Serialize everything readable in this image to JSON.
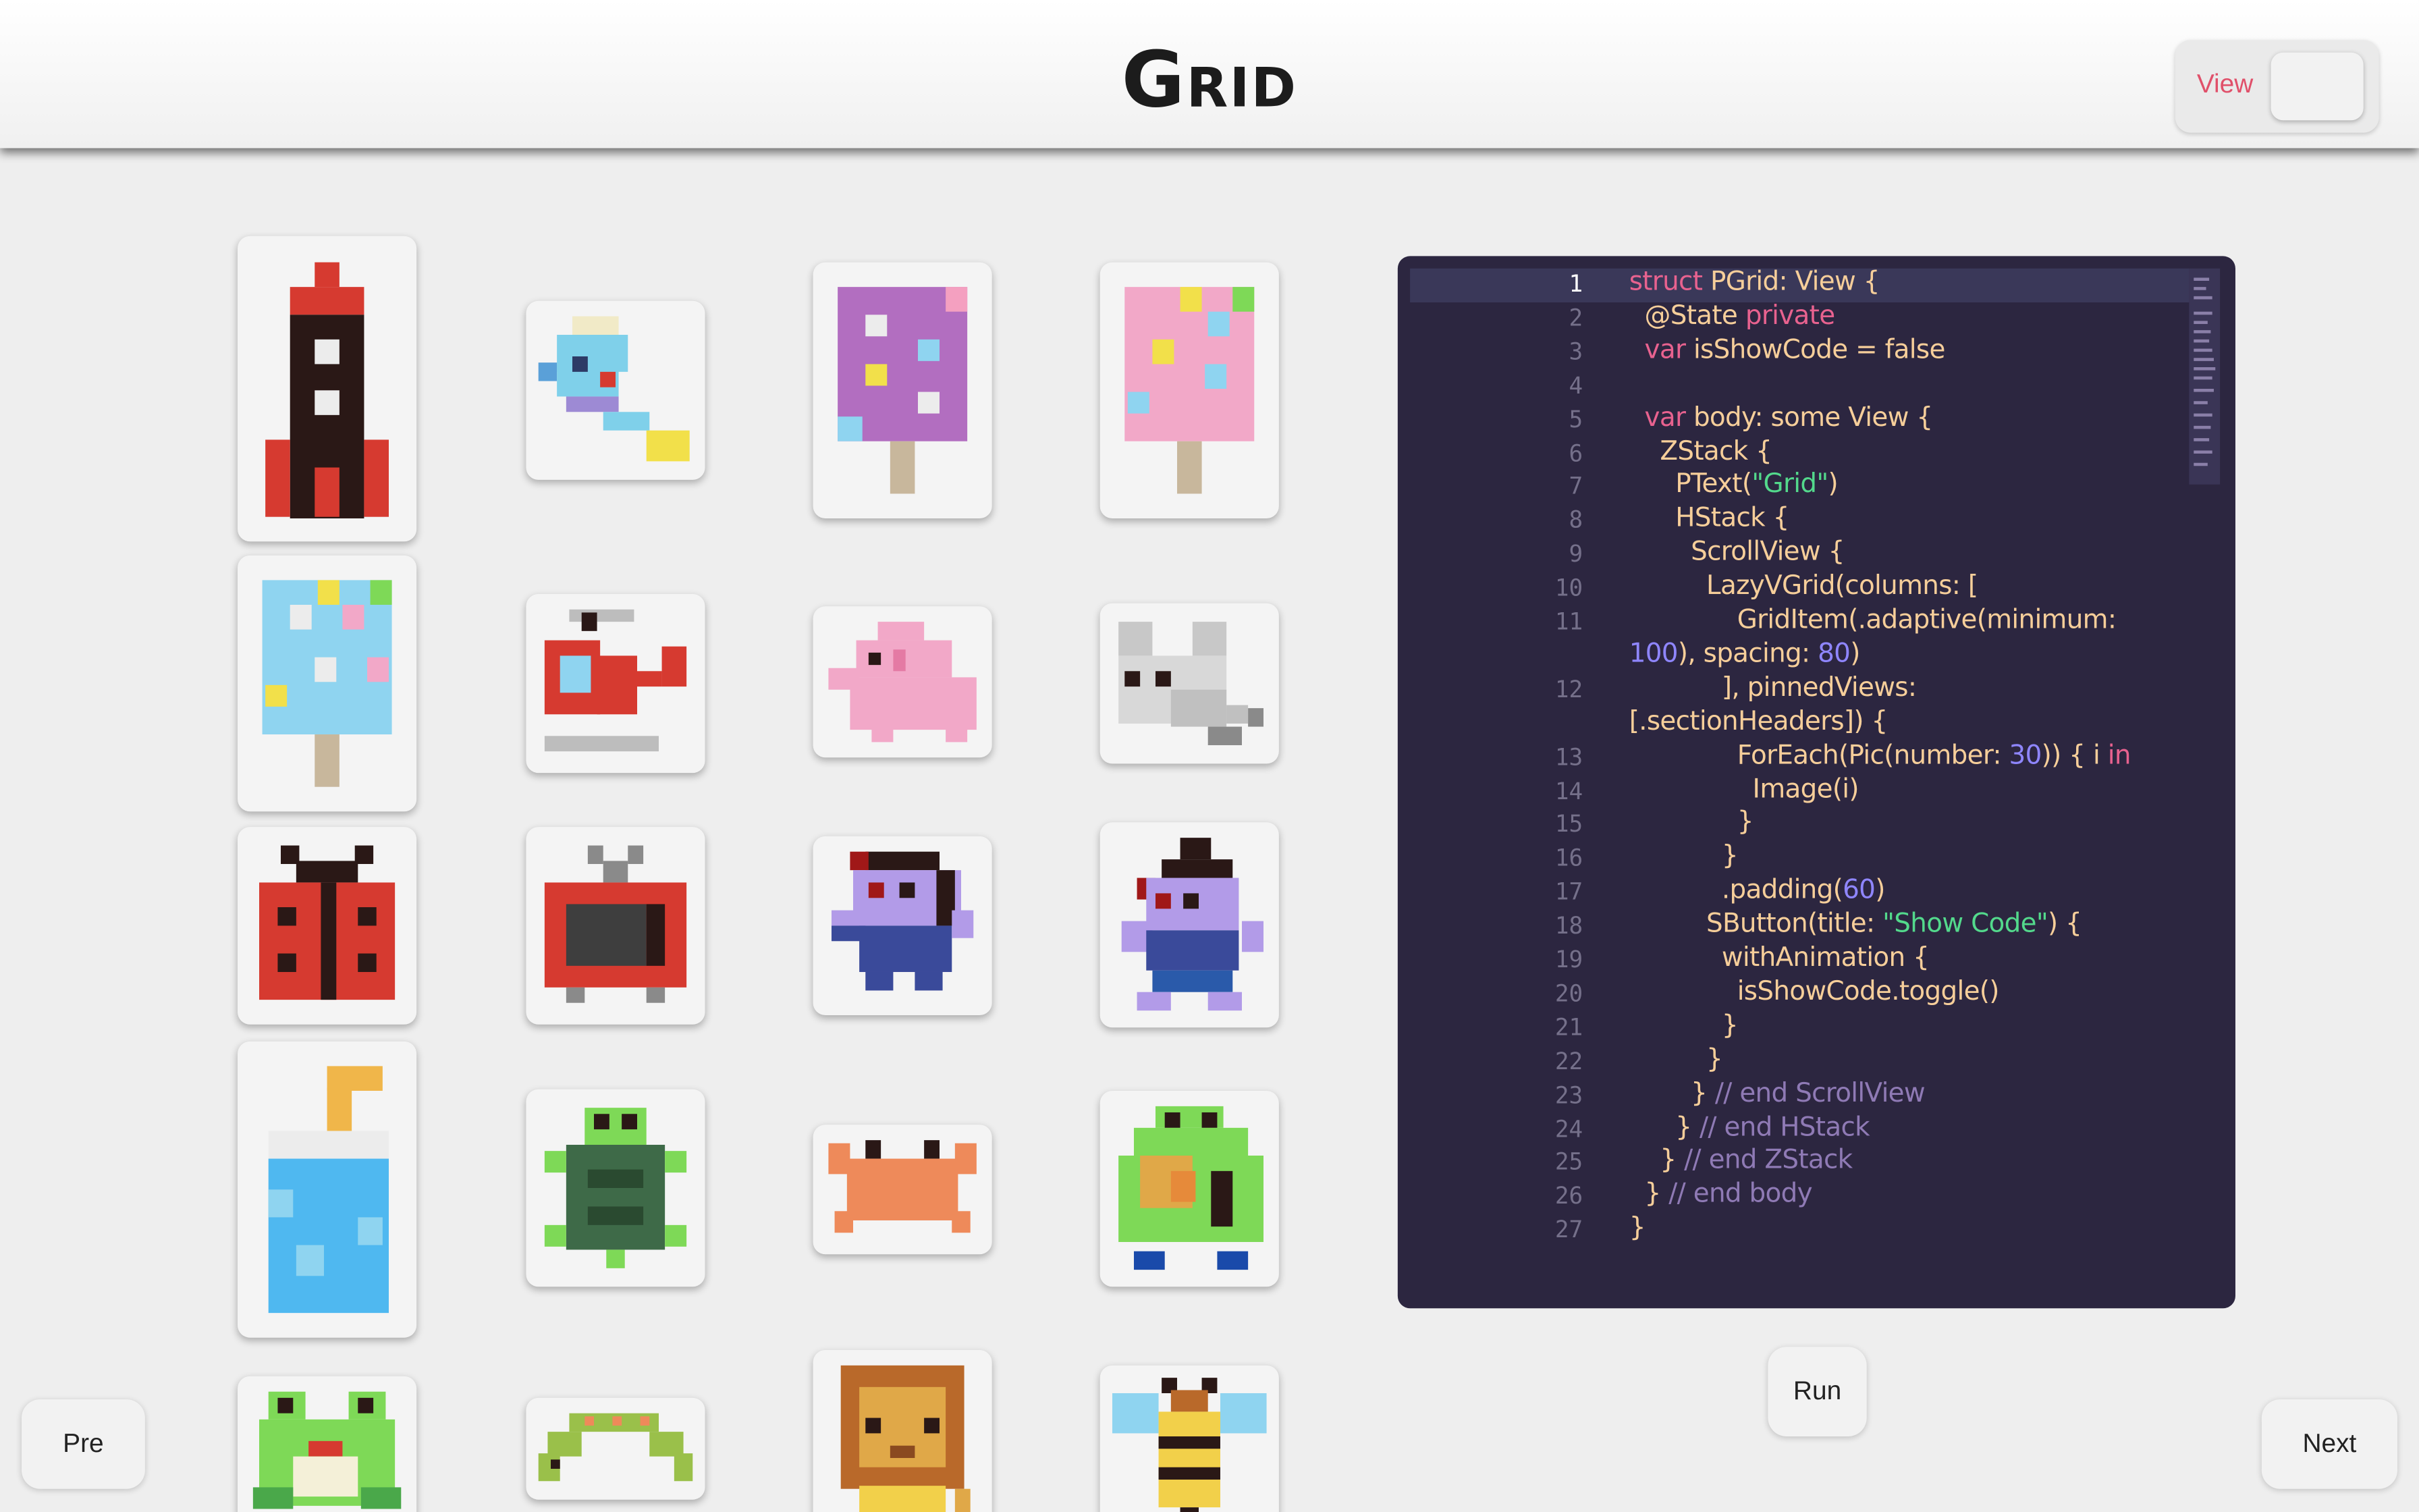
{
  "header": {
    "title": "Grid",
    "view_label": "View"
  },
  "grid": {
    "items": [
      "rocket-icon",
      "fish-icon",
      "popsicle-purple-icon",
      "popsicle-pink-icon",
      "popsicle-blue-icon",
      "helicopter-icon",
      "elephant-icon",
      "mouse-icon",
      "ladybug-icon",
      "tv-icon",
      "ninja-purple-icon",
      "robot-purple-icon",
      "drink-icon",
      "turtle-icon",
      "crab-icon",
      "monster-green-icon",
      "frog-icon",
      "caterpillar-icon",
      "lion-icon",
      "bee-icon"
    ]
  },
  "editor": {
    "line_numbers": [
      "1",
      "2",
      "3",
      "4",
      "5",
      "6",
      "7",
      "8",
      "9",
      "10",
      "11",
      "",
      "12",
      "",
      "13",
      "14",
      "15",
      "16",
      "17",
      "18",
      "19",
      "20",
      "21",
      "22",
      "23",
      "24",
      "25",
      "26",
      "27"
    ],
    "lines": [
      [
        [
          "kw",
          "struct"
        ],
        [
          "",
          "PGrid: View {"
        ]
      ],
      [
        [
          "",
          "@State "
        ],
        [
          "kw",
          "private"
        ]
      ],
      [
        [
          "kw",
          "var"
        ],
        [
          "",
          "isShowCode = false"
        ]
      ],
      [],
      [
        [
          "kw",
          "var"
        ],
        [
          "",
          "body: some View {"
        ]
      ],
      [
        [
          "",
          "ZStack {"
        ]
      ],
      [
        [
          "",
          "PText("
        ],
        [
          "str",
          "\"Grid\""
        ],
        [
          "",
          ")"
        ]
      ],
      [
        [
          "",
          "HStack {"
        ]
      ],
      [
        [
          "",
          "ScrollView {"
        ]
      ],
      [
        [
          "",
          "LazyVGrid(columns: ["
        ]
      ],
      [
        [
          "",
          "GridItem(.adaptive(minimum:"
        ]
      ],
      [
        [
          "num",
          "100"
        ],
        [
          "",
          "), spacing: "
        ],
        [
          "num",
          "80"
        ],
        [
          "",
          ")"
        ]
      ],
      [
        [
          "",
          "], pinnedViews:"
        ]
      ],
      [
        [
          "",
          "[.sectionHeaders]) {"
        ]
      ],
      [
        [
          "",
          "ForEach(Pic(number: "
        ],
        [
          "num",
          "30"
        ],
        [
          "",
          ")) { i "
        ],
        [
          "kw",
          "in"
        ]
      ],
      [
        [
          "",
          "Image(i)"
        ]
      ],
      [
        [
          "",
          "}"
        ]
      ],
      [
        [
          "",
          "}"
        ]
      ],
      [
        [
          "",
          ".padding("
        ],
        [
          "num",
          "60"
        ],
        [
          "",
          ")"
        ]
      ],
      [
        [
          "",
          "SButton(title: "
        ],
        [
          "str",
          "\"Show Code\""
        ],
        [
          "",
          ") {"
        ]
      ],
      [
        [
          "",
          "withAnimation {"
        ]
      ],
      [
        [
          "",
          "isShowCode.toggle()"
        ]
      ],
      [
        [
          "",
          "}"
        ]
      ],
      [
        [
          "",
          "}"
        ]
      ],
      [
        [
          "",
          "} "
        ],
        [
          "cm",
          "// end ScrollView"
        ]
      ],
      [
        [
          "",
          "} "
        ],
        [
          "cm",
          "// end HStack"
        ]
      ],
      [
        [
          "",
          "} "
        ],
        [
          "cm",
          "// end ZStack"
        ]
      ],
      [
        [
          "",
          "} "
        ],
        [
          "cm",
          "// end body"
        ]
      ],
      [
        [
          "",
          "}"
        ]
      ]
    ]
  },
  "buttons": {
    "pre": "Pre",
    "run": "Run",
    "next": "Next"
  },
  "colors": {
    "editor_bg": "#2c2640",
    "keyword": "#e8628f",
    "string": "#53d98c",
    "number": "#8f86ff",
    "comment": "#8f7ab5",
    "default_code": "#f6ce9a"
  }
}
